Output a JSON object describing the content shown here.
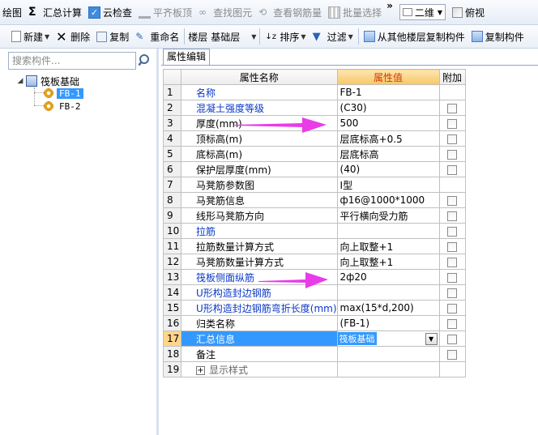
{
  "toolbar_top": {
    "draw": "绘图",
    "sum_calc": "汇总计算",
    "cloud_check": "云检查",
    "flush_slab": "平齐板顶",
    "find_element": "查找图元",
    "view_rebar": "查看钢筋量",
    "batch_select": "批量选择",
    "overflow": "»",
    "view_mode": "二维",
    "view_angle": "俯视"
  },
  "toolbar_second": {
    "new": "新建",
    "delete": "删除",
    "copy": "复制",
    "rename": "重命名",
    "floor_label": "楼层",
    "floor_value": "基础层",
    "sort": "排序",
    "filter": "过滤",
    "copy_from_floor": "从其他楼层复制构件",
    "copy_member": "复制构件"
  },
  "left_panel": {
    "search_placeholder": "搜索构件...",
    "tree": {
      "root": "筏板基础",
      "children": [
        "FB-1",
        "FB-2"
      ],
      "selected": "FB-1"
    }
  },
  "property_editor": {
    "tab": "属性编辑",
    "headers": {
      "name": "属性名称",
      "value": "属性值",
      "extra": "附加"
    },
    "rows": [
      {
        "n": "1",
        "name": "名称",
        "value": "FB-1",
        "blue": true,
        "checkbox": false
      },
      {
        "n": "2",
        "name": "混凝土强度等级",
        "value": "(C30)",
        "blue": true,
        "checkbox": true
      },
      {
        "n": "3",
        "name": "厚度(mm)",
        "value": "500",
        "blue": false,
        "checkbox": true
      },
      {
        "n": "4",
        "name": "顶标高(m)",
        "value": "层底标高+0.5",
        "blue": false,
        "checkbox": true
      },
      {
        "n": "5",
        "name": "底标高(m)",
        "value": "层底标高",
        "blue": false,
        "checkbox": true
      },
      {
        "n": "6",
        "name": "保护层厚度(mm)",
        "value": "(40)",
        "blue": false,
        "checkbox": true
      },
      {
        "n": "7",
        "name": "马凳筋参数图",
        "value": "Ⅰ型",
        "blue": false,
        "checkbox": false
      },
      {
        "n": "8",
        "name": "马凳筋信息",
        "value": "ф16@1000*1000",
        "blue": false,
        "checkbox": true
      },
      {
        "n": "9",
        "name": "线形马凳筋方向",
        "value": "平行横向受力筋",
        "blue": false,
        "checkbox": true
      },
      {
        "n": "10",
        "name": "拉筋",
        "value": "",
        "blue": true,
        "checkbox": true
      },
      {
        "n": "11",
        "name": "拉筋数量计算方式",
        "value": "向上取整+1",
        "blue": false,
        "checkbox": true
      },
      {
        "n": "12",
        "name": "马凳筋数量计算方式",
        "value": "向上取整+1",
        "blue": false,
        "checkbox": true
      },
      {
        "n": "13",
        "name": "筏板侧面纵筋",
        "value": "2ф20",
        "blue": true,
        "checkbox": true
      },
      {
        "n": "14",
        "name": "U形构造封边钢筋",
        "value": "",
        "blue": true,
        "checkbox": true
      },
      {
        "n": "15",
        "name": "U形构造封边钢筋弯折长度(mm)",
        "value": "max(15*d,200)",
        "blue": true,
        "checkbox": true
      },
      {
        "n": "16",
        "name": "归类名称",
        "value": "(FB-1)",
        "blue": false,
        "checkbox": true
      },
      {
        "n": "17",
        "name": "汇总信息",
        "value": "筏板基础",
        "blue": false,
        "checkbox": true,
        "selected": true
      },
      {
        "n": "18",
        "name": "备注",
        "value": "",
        "blue": false,
        "checkbox": true
      },
      {
        "n": "19",
        "name": "显示样式",
        "value": "",
        "blue": false,
        "checkbox": false,
        "expandable": true
      }
    ]
  },
  "colors": {
    "annotation_arrow": "#e83ce8",
    "selection": "#3399ff",
    "value_header": "#f7c765",
    "blue_text": "#0a38c8"
  }
}
